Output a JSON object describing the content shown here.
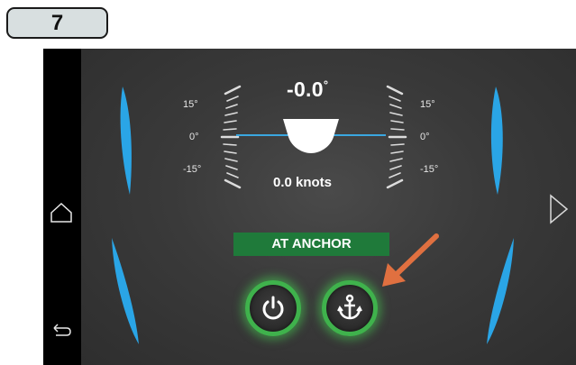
{
  "step_badge": "7",
  "nav": {
    "home_icon": "home-outline-icon",
    "back_icon": "back-arrow-icon",
    "next_icon": "next-arrow-icon"
  },
  "heading": {
    "value": "-0.0",
    "degree_symbol": "°",
    "left_scale_labels": [
      "15°",
      "0°",
      "-15°"
    ],
    "right_scale_labels": [
      "15°",
      "0°",
      "-15°"
    ]
  },
  "speed": {
    "text": "0.0 knots"
  },
  "mode": {
    "label": "AT ANCHOR",
    "color": "#1f7a3a"
  },
  "buttons": {
    "power_icon": "power-icon",
    "anchor_icon": "anchor-icon"
  },
  "colors": {
    "accent_blue": "#2aa5e6",
    "horizon_line": "#3aa7e0",
    "button_glow": "#3fb24c",
    "callout_arrow": "#e07040"
  }
}
